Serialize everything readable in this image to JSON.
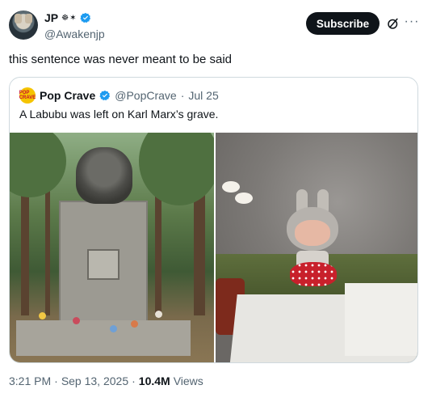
{
  "author": {
    "name": "JP",
    "name_glyphs": "☸✶",
    "handle": "@Awakenjp"
  },
  "actions": {
    "subscribe_label": "Subscribe",
    "grok_icon": "grok-icon",
    "more_icon": "more-icon"
  },
  "tweet": {
    "text": "this sentence was never meant to be said"
  },
  "quote": {
    "name": "Pop Crave",
    "avatar_text": "POP CRAVE",
    "handle": "@PopCrave",
    "separator": "·",
    "date": "Jul 25",
    "text": "A Labubu was left on Karl Marx’s grave."
  },
  "footer": {
    "time": "3:21 PM",
    "sep1": "·",
    "date": "Sep 13, 2025",
    "sep2": "·",
    "views_count": "10.4M",
    "views_label": "Views"
  },
  "colors": {
    "accent": "#0f1419",
    "verified": "#1d9bf0",
    "muted": "#536471"
  }
}
